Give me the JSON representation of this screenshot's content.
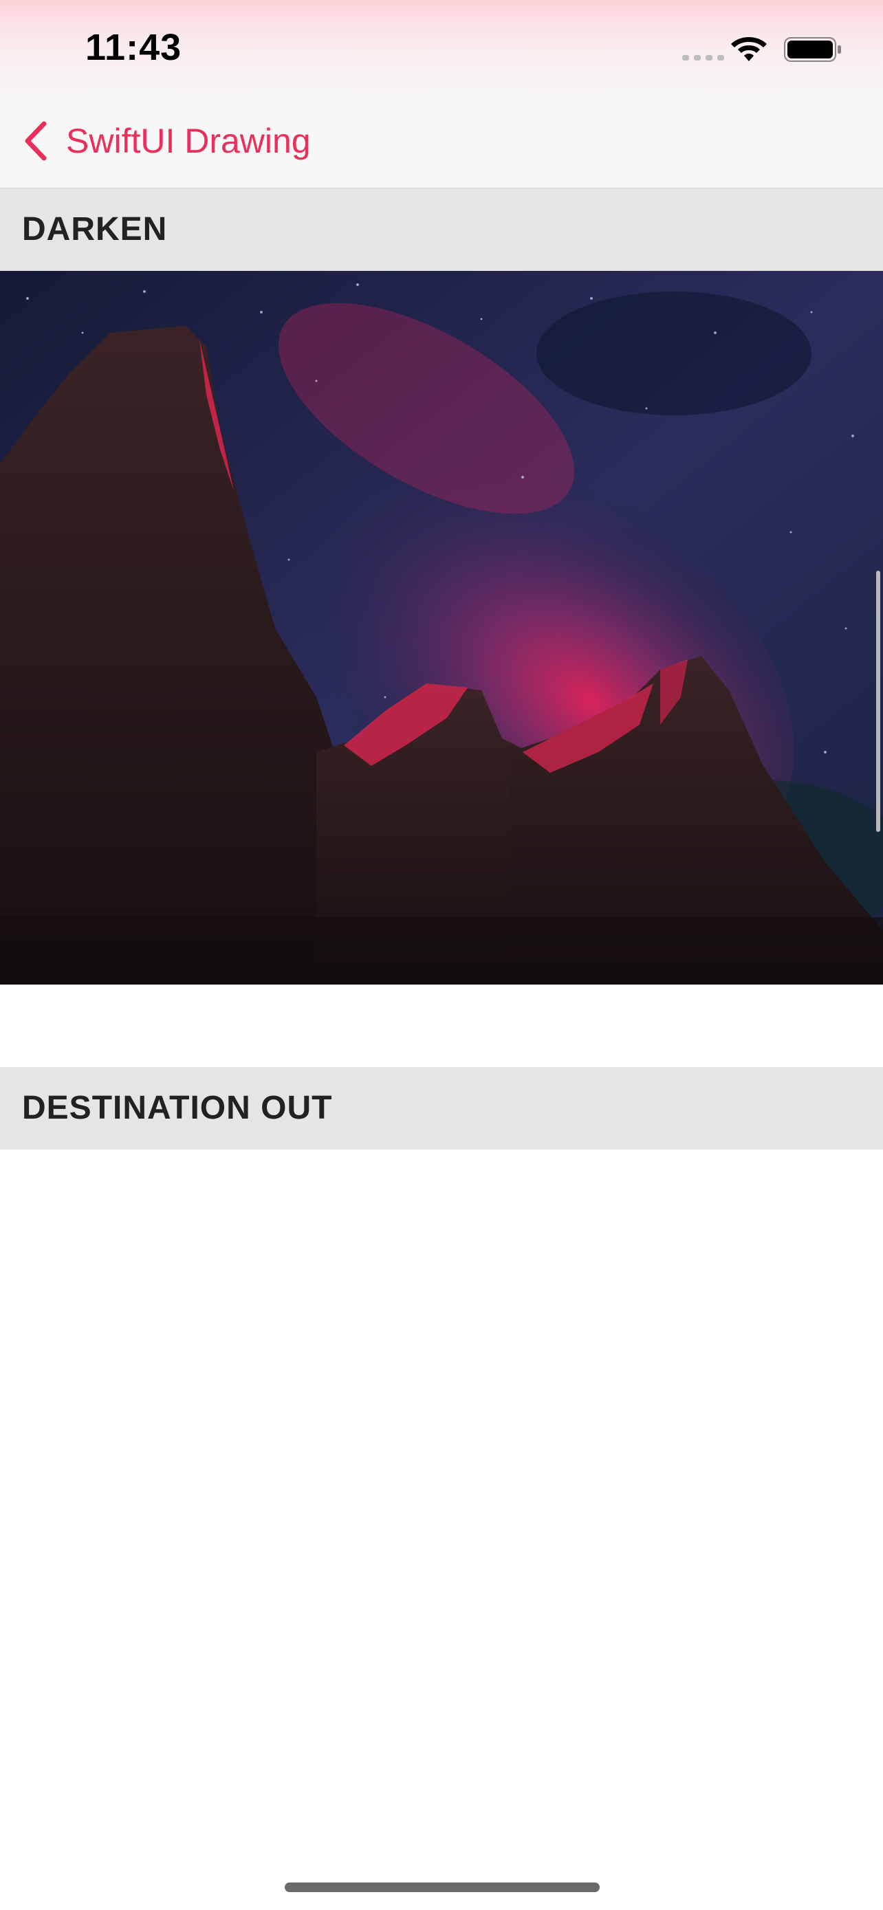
{
  "status_bar": {
    "time": "11:43",
    "icons": [
      "cellular-signal-icon",
      "wifi-icon",
      "battery-icon"
    ]
  },
  "nav_bar": {
    "back_label": "SwiftUI Drawing",
    "accent_color": "#e8305a"
  },
  "sections": [
    {
      "title": "DARKEN",
      "image": "night-sky-mountain-photo"
    },
    {
      "title": "DESTINATION OUT"
    }
  ]
}
